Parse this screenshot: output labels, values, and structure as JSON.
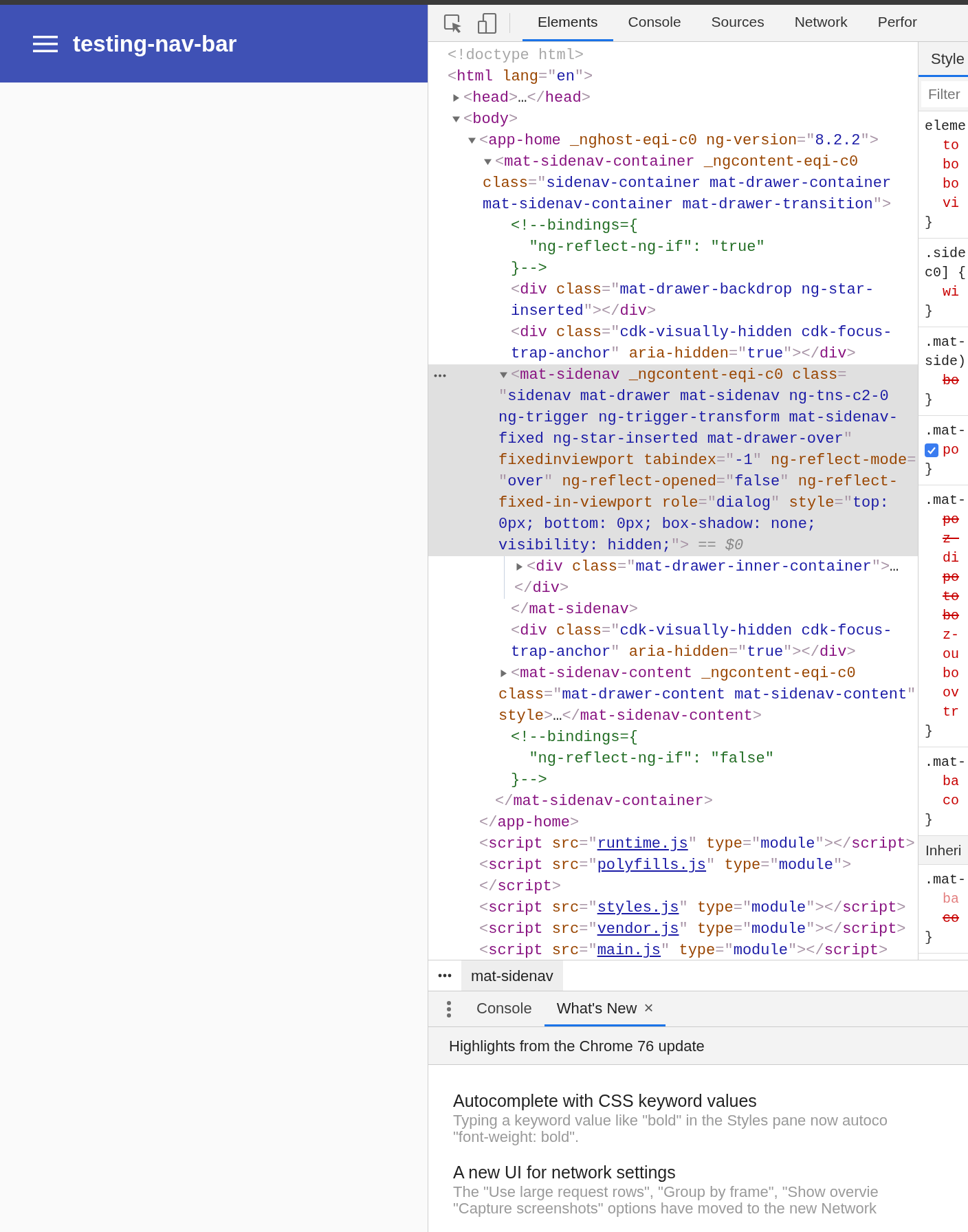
{
  "app": {
    "title": "testing-nav-bar"
  },
  "devtools": {
    "tabs": [
      {
        "label": "Elements",
        "selected": true
      },
      {
        "label": "Console",
        "selected": false
      },
      {
        "label": "Sources",
        "selected": false
      },
      {
        "label": "Network",
        "selected": false
      },
      {
        "label": "Perfor",
        "selected": false
      }
    ],
    "dom_tree": [
      {
        "kind": "doctype",
        "lines": [
          "<!doctype html>"
        ],
        "selected": false
      },
      {
        "kind": "element",
        "lines": [
          "<html lang=\"en\">"
        ],
        "selected": false,
        "children": [
          {
            "kind": "element",
            "lines": [
              "<head>…</head>"
            ],
            "expanded": false,
            "selected": false
          },
          {
            "kind": "element",
            "lines": [
              "<body>"
            ],
            "expanded": true,
            "selected": false,
            "children": [
              {
                "kind": "element",
                "lines": [
                  "<app-home _nghost-eqi-c0 ng-version=\"8.2.2\">"
                ],
                "expanded": true,
                "selected": false,
                "closing": "</app-home>",
                "children": [
                  {
                    "kind": "element",
                    "lines": [
                      "<mat-sidenav-container _ngcontent-eqi-c0",
                      "class=\"sidenav-container mat-drawer-container",
                      "mat-sidenav-container mat-drawer-transition\">"
                    ],
                    "expanded": true,
                    "selected": false,
                    "closing": "</mat-sidenav-container>",
                    "children": [
                      {
                        "kind": "comment",
                        "lines": [
                          "<!--bindings={",
                          "  \"ng-reflect-ng-if\": \"true\"",
                          "}-->"
                        ],
                        "selected": false
                      },
                      {
                        "kind": "element",
                        "lines": [
                          "<div class=\"mat-drawer-backdrop ng-star-",
                          "inserted\"></div>"
                        ],
                        "selected": false
                      },
                      {
                        "kind": "element",
                        "lines": [
                          "<div class=\"cdk-visually-hidden cdk-focus-",
                          "trap-anchor\" aria-hidden=\"true\"></div>"
                        ],
                        "selected": false
                      },
                      {
                        "kind": "element",
                        "lines": [
                          "<mat-sidenav _ngcontent-eqi-c0 class=",
                          "\"sidenav mat-drawer mat-sidenav ng-tns-c2-0",
                          "ng-trigger ng-trigger-transform mat-sidenav-",
                          "fixed ng-star-inserted mat-drawer-over\"",
                          "fixedinviewport tabindex=\"-1\" ng-reflect-mode=",
                          "\"over\" ng-reflect-opened=\"false\" ng-reflect-",
                          "fixed-in-viewport role=\"dialog\" style=\"top:",
                          "0px; bottom: 0px; box-shadow: none;",
                          "visibility: hidden;\">"
                        ],
                        "console_ref": "== $0",
                        "expanded": true,
                        "selected": true,
                        "closing": "</mat-sidenav>",
                        "children": [
                          {
                            "kind": "element",
                            "lines": [
                              "<div class=\"mat-drawer-inner-container\">…",
                              "</div>"
                            ],
                            "expanded": false,
                            "selected": false
                          }
                        ]
                      },
                      {
                        "kind": "element",
                        "lines": [
                          "<div class=\"cdk-visually-hidden cdk-focus-",
                          "trap-anchor\" aria-hidden=\"true\"></div>"
                        ],
                        "selected": false
                      },
                      {
                        "kind": "element",
                        "lines": [
                          "<mat-sidenav-content _ngcontent-eqi-c0",
                          "class=\"mat-drawer-content mat-sidenav-content\"",
                          "style>…</mat-sidenav-content>"
                        ],
                        "expanded": false,
                        "selected": false
                      },
                      {
                        "kind": "comment",
                        "lines": [
                          "<!--bindings={",
                          "  \"ng-reflect-ng-if\": \"false\"",
                          "}-->"
                        ],
                        "selected": false
                      }
                    ]
                  }
                ]
              },
              {
                "kind": "element",
                "lines": [
                  "<script src=\"runtime.js\" type=\"module\"></script>"
                ],
                "link": true,
                "selected": false
              },
              {
                "kind": "element",
                "lines": [
                  "<script src=\"polyfills.js\" type=\"module\">",
                  "</script>"
                ],
                "link": true,
                "selected": false
              },
              {
                "kind": "element",
                "lines": [
                  "<script src=\"styles.js\" type=\"module\"></script>"
                ],
                "link": true,
                "selected": false
              },
              {
                "kind": "element",
                "lines": [
                  "<script src=\"vendor.js\" type=\"module\"></script>"
                ],
                "link": true,
                "selected": false
              },
              {
                "kind": "element",
                "lines": [
                  "<script src=\"main.js\" type=\"module\"></script>"
                ],
                "link": true,
                "selected": false
              }
            ]
          }
        ]
      }
    ],
    "breadcrumb": [
      {
        "label": "mat-sidenav",
        "selected": true
      }
    ],
    "styles": {
      "tab": "Style",
      "filter_placeholder": "Filter",
      "sections": [
        {
          "kind": "rule",
          "selector": [
            "eleme"
          ],
          "declarations": [
            {
              "text": "to",
              "struck": false
            },
            {
              "text": "bo",
              "struck": false
            },
            {
              "text": "bo",
              "struck": false
            },
            {
              "text": "vi",
              "struck": false
            }
          ],
          "close": "}"
        },
        {
          "kind": "rule",
          "selector": [
            ".side",
            "c0] {"
          ],
          "declarations": [
            {
              "text": "wi",
              "struck": false
            }
          ],
          "close": "}"
        },
        {
          "kind": "rule",
          "selector": [
            ".mat-",
            "side)"
          ],
          "declarations": [
            {
              "text": "bo",
              "struck": true
            }
          ],
          "close": "}"
        },
        {
          "kind": "rule",
          "selector": [
            ".mat-"
          ],
          "declarations": [
            {
              "text": "po",
              "struck": false,
              "checked": true
            }
          ],
          "close": "}"
        },
        {
          "kind": "rule",
          "selector": [
            ".mat-"
          ],
          "declarations": [
            {
              "text": "po",
              "struck": true
            },
            {
              "text": "z-",
              "struck": true
            },
            {
              "text": "di",
              "struck": false
            },
            {
              "text": "po",
              "struck": true
            },
            {
              "text": "to",
              "struck": true
            },
            {
              "text": "bo",
              "struck": true
            },
            {
              "text": "z-",
              "struck": false
            },
            {
              "text": "ou",
              "struck": false
            },
            {
              "text": "bo",
              "struck": false
            },
            {
              "text": "ov",
              "struck": false
            },
            {
              "text": "tr",
              "struck": false
            }
          ],
          "close": "}"
        },
        {
          "kind": "rule",
          "selector": [
            ".mat-"
          ],
          "declarations": [
            {
              "text": "ba",
              "struck": false
            },
            {
              "text": "co",
              "struck": false
            }
          ],
          "close": "}"
        },
        {
          "kind": "header",
          "label": "Inheri"
        },
        {
          "kind": "rule",
          "selector": [
            ".mat-"
          ],
          "declarations": [
            {
              "text": "ba",
              "struck": false,
              "inactive": true
            },
            {
              "text": "co",
              "struck": true
            }
          ],
          "close": "}"
        }
      ]
    },
    "drawer": {
      "tabs": [
        {
          "label": "Console",
          "selected": false
        },
        {
          "label": "What's New",
          "selected": true,
          "close": "×"
        }
      ],
      "banner": "Highlights from the Chrome 76 update",
      "items": [
        {
          "title": "Autocomplete with CSS keyword values",
          "lines": [
            "Typing a keyword value like \"bold\" in the Styles pane now autoco",
            "\"font-weight: bold\"."
          ]
        },
        {
          "title": "A new UI for network settings",
          "lines": [
            "The \"Use large request rows\", \"Group by frame\", \"Show overvie",
            "\"Capture screenshots\" options have moved to the new Network"
          ]
        }
      ]
    }
  }
}
